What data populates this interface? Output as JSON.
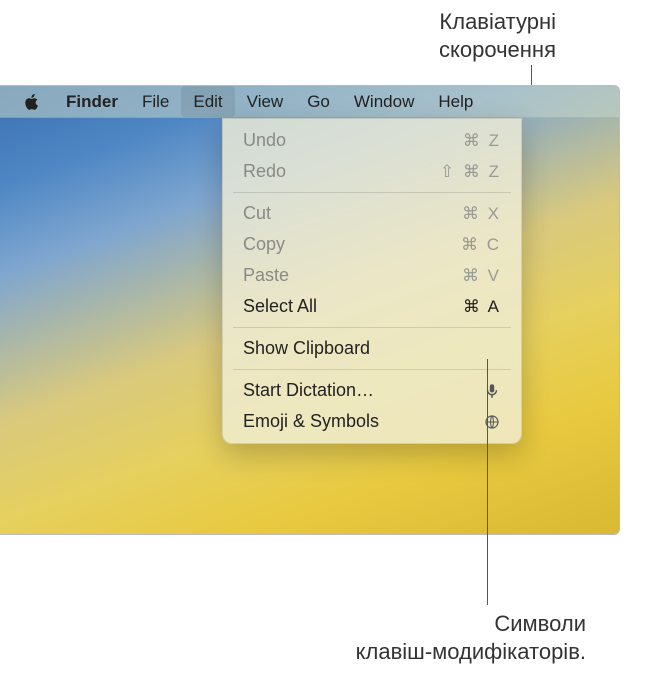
{
  "callouts": {
    "top_line1": "Клавіатурні",
    "top_line2": "скорочення",
    "bottom_line1": "Символи",
    "bottom_line2": "клавіш-модифікаторів."
  },
  "menubar": {
    "app": "Finder",
    "items": [
      "File",
      "Edit",
      "View",
      "Go",
      "Window",
      "Help"
    ]
  },
  "edit_menu": {
    "groups": [
      [
        {
          "label": "Undo",
          "shortcut": "⌘ Z",
          "enabled": false
        },
        {
          "label": "Redo",
          "shortcut": "⇧ ⌘ Z",
          "enabled": false
        }
      ],
      [
        {
          "label": "Cut",
          "shortcut": "⌘ X",
          "enabled": false
        },
        {
          "label": "Copy",
          "shortcut": "⌘ C",
          "enabled": false
        },
        {
          "label": "Paste",
          "shortcut": "⌘ V",
          "enabled": false
        },
        {
          "label": "Select All",
          "shortcut": "⌘ A",
          "enabled": true
        }
      ],
      [
        {
          "label": "Show Clipboard",
          "shortcut": "",
          "enabled": true
        }
      ],
      [
        {
          "label": "Start Dictation…",
          "shortcut": "",
          "icon": "mic",
          "enabled": true
        },
        {
          "label": "Emoji & Symbols",
          "shortcut": "",
          "icon": "globe",
          "enabled": true
        }
      ]
    ]
  }
}
